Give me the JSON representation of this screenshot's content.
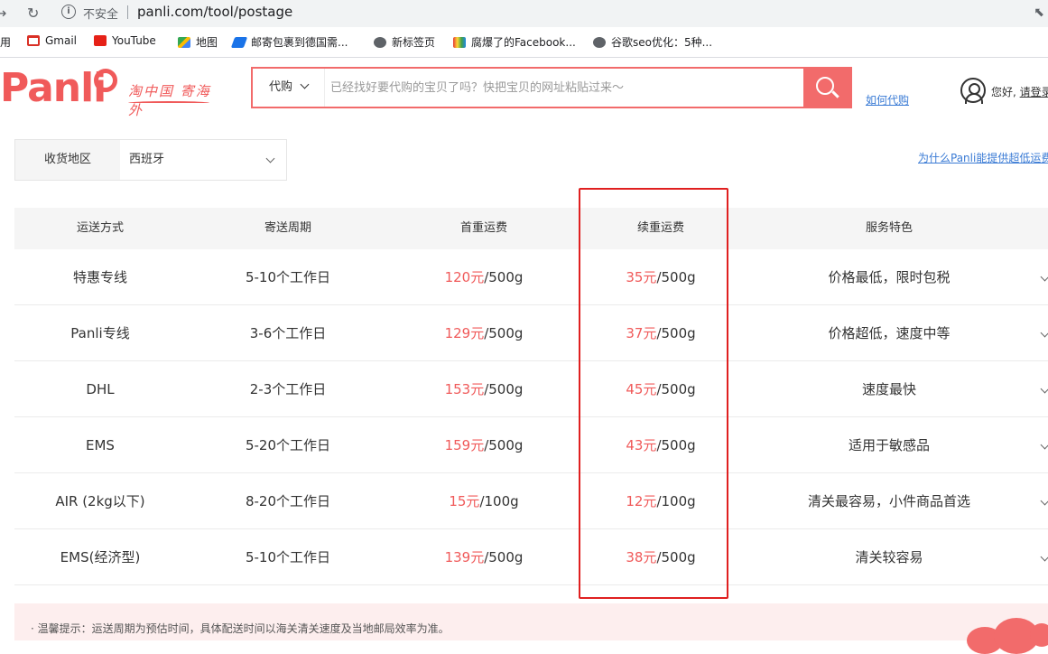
{
  "browser": {
    "security_label": "不安全",
    "url": "panli.com/tool/postage",
    "bookmarks": [
      {
        "label": "用",
        "icon": "apps-icon"
      },
      {
        "label": "Gmail",
        "icon": "gmail-icon"
      },
      {
        "label": "YouTube",
        "icon": "youtube-icon"
      },
      {
        "label": "地图",
        "icon": "maps-icon"
      },
      {
        "label": "邮寄包裹到德国需...",
        "icon": "bookmark-icon"
      },
      {
        "label": "新标签页",
        "icon": "globe-icon"
      },
      {
        "label": "腐爆了的Facebook...",
        "icon": "colorful-icon"
      },
      {
        "label": "谷歌seo优化：5种...",
        "icon": "globe-icon"
      }
    ]
  },
  "header": {
    "logo_text": "Panli",
    "slogan": "淘中国 寄海外",
    "search": {
      "type_label": "代购",
      "placeholder": "已经找好要代购的宝贝了吗？快把宝贝的网址粘贴过来～"
    },
    "how_link": "如何代购",
    "greeting": "您好, ",
    "login_link": "请登录"
  },
  "region": {
    "label": "收货地区",
    "value": "西班牙"
  },
  "why_link": "为什么Panli能提供超低运费",
  "table": {
    "headers": [
      "运送方式",
      "寄送周期",
      "首重运费",
      "续重运费",
      "服务特色"
    ],
    "rows": [
      {
        "method": "特惠专线",
        "period": "5-10个工作日",
        "first_price": "120元",
        "first_unit": "/500g",
        "next_price": "35元",
        "next_unit": "/500g",
        "feature": "价格最低，限时包税"
      },
      {
        "method": "Panli专线",
        "period": "3-6个工作日",
        "first_price": "129元",
        "first_unit": "/500g",
        "next_price": "37元",
        "next_unit": "/500g",
        "feature": "价格超低，速度中等"
      },
      {
        "method": "DHL",
        "period": "2-3个工作日",
        "first_price": "153元",
        "first_unit": "/500g",
        "next_price": "45元",
        "next_unit": "/500g",
        "feature": "速度最快"
      },
      {
        "method": "EMS",
        "period": "5-20个工作日",
        "first_price": "159元",
        "first_unit": "/500g",
        "next_price": "43元",
        "next_unit": "/500g",
        "feature": "适用于敏感品"
      },
      {
        "method": "AIR (2kg以下)",
        "period": "8-20个工作日",
        "first_price": "15元",
        "first_unit": "/100g",
        "next_price": "12元",
        "next_unit": "/100g",
        "feature": "清关最容易，小件商品首选"
      },
      {
        "method": "EMS(经济型)",
        "period": "5-10个工作日",
        "first_price": "139元",
        "first_unit": "/500g",
        "next_price": "38元",
        "next_unit": "/500g",
        "feature": "清关较容易"
      }
    ]
  },
  "tip": "· 温馨提示：运送周期为预估时间，具体配送时间以海关清关速度及当地邮局效率为准。",
  "colors": {
    "brand": "#f05a5a",
    "link": "#3a7bd5",
    "highlight": "#e02020"
  }
}
